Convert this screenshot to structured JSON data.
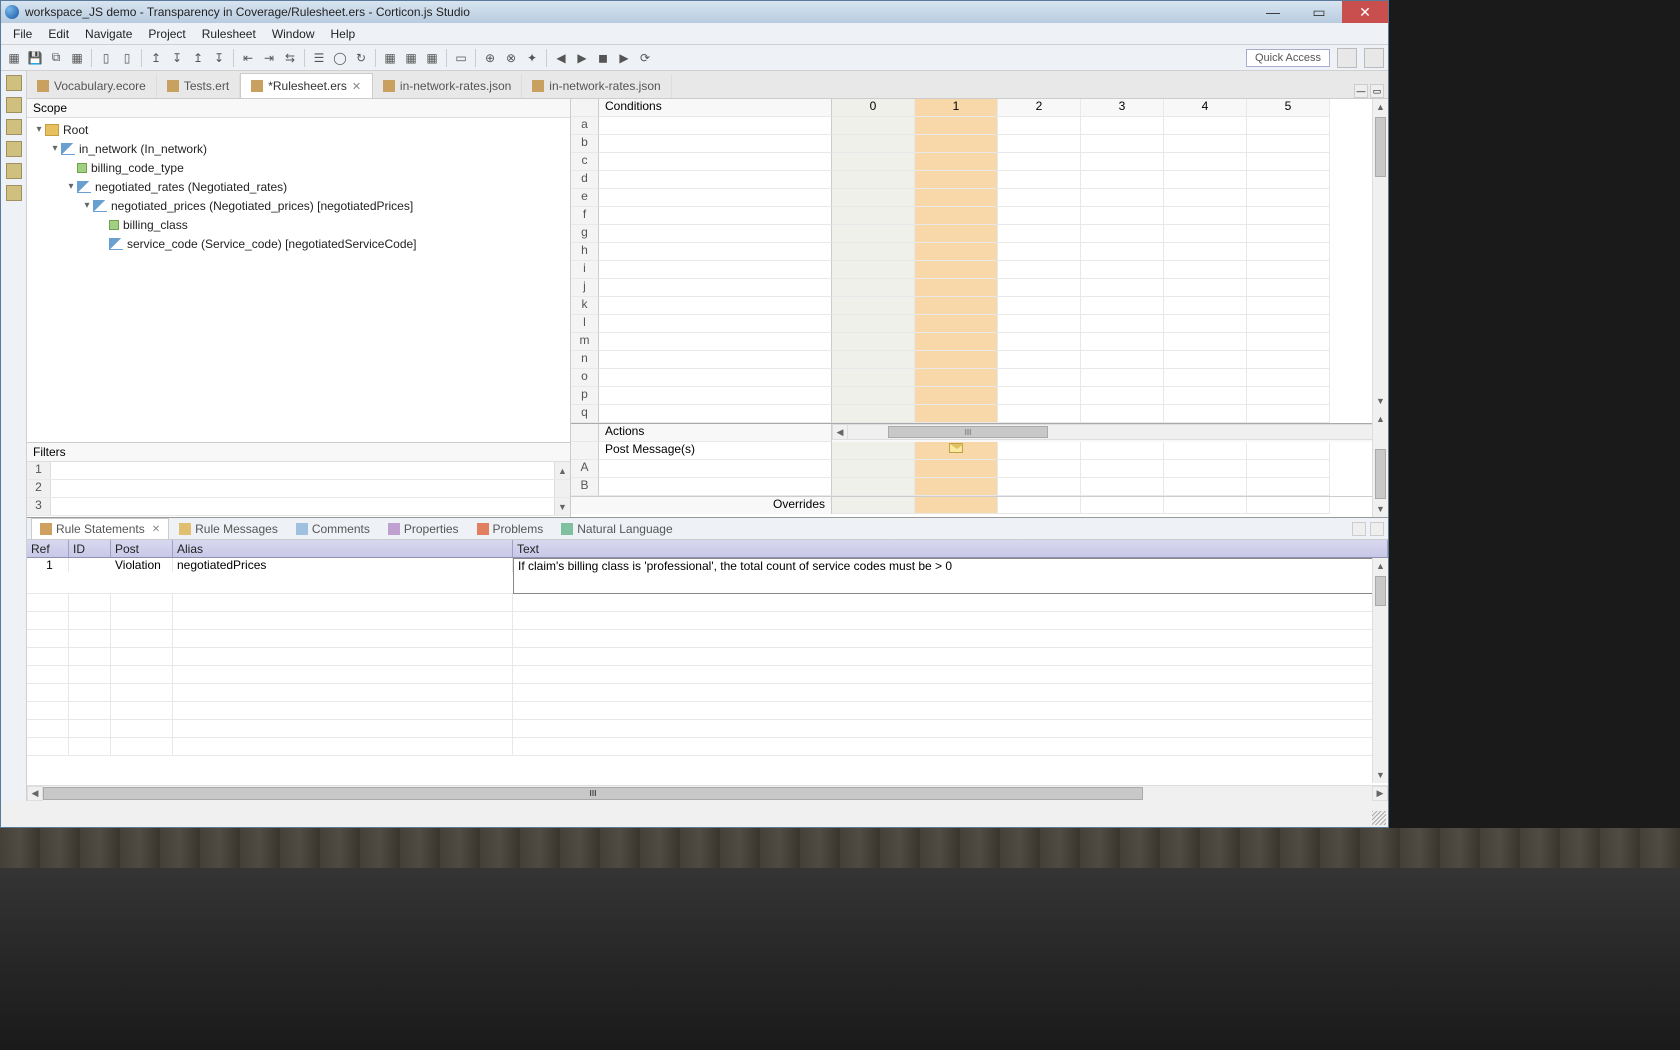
{
  "title": "workspace_JS demo - Transparency in Coverage/Rulesheet.ers - Corticon.js Studio",
  "menu": [
    "File",
    "Edit",
    "Navigate",
    "Project",
    "Rulesheet",
    "Window",
    "Help"
  ],
  "quick_access": "Quick Access",
  "tabs": [
    {
      "label": "Vocabulary.ecore",
      "active": false,
      "dirty": false
    },
    {
      "label": "Tests.ert",
      "active": false,
      "dirty": false
    },
    {
      "label": "*Rulesheet.ers",
      "active": true,
      "dirty": true
    },
    {
      "label": "in-network-rates.json",
      "active": false,
      "dirty": false
    },
    {
      "label": "in-network-rates.json",
      "active": false,
      "dirty": false
    }
  ],
  "scope": {
    "header": "Scope",
    "tree": [
      {
        "indent": 0,
        "expand": "▾",
        "icon": "folder",
        "label": "Root"
      },
      {
        "indent": 1,
        "expand": "▾",
        "icon": "link",
        "label": "in_network (In_network)"
      },
      {
        "indent": 2,
        "expand": "",
        "icon": "attr",
        "label": "billing_code_type"
      },
      {
        "indent": 2,
        "expand": "▾",
        "icon": "link",
        "label": "negotiated_rates (Negotiated_rates)"
      },
      {
        "indent": 3,
        "expand": "▾",
        "icon": "link",
        "label": "negotiated_prices (Negotiated_prices) [negotiatedPrices]"
      },
      {
        "indent": 4,
        "expand": "",
        "icon": "attr",
        "label": "billing_class"
      },
      {
        "indent": 4,
        "expand": "",
        "icon": "link",
        "label": "service_code (Service_code) [negotiatedServiceCode]"
      }
    ]
  },
  "filters": {
    "header": "Filters",
    "rows": [
      "1",
      "2",
      "3"
    ]
  },
  "grid": {
    "conditions_label": "Conditions",
    "actions_label": "Actions",
    "post_label": "Post Message(s)",
    "overrides_label": "Overrides",
    "cols": [
      "0",
      "1",
      "2",
      "3",
      "4",
      "5"
    ],
    "cond_rows": [
      "a",
      "b",
      "c",
      "d",
      "e",
      "f",
      "g",
      "h",
      "i",
      "j",
      "k",
      "l",
      "m",
      "n",
      "o",
      "p",
      "q"
    ],
    "act_rows": [
      "A",
      "B"
    ]
  },
  "bottom": {
    "tabs": [
      "Rule Statements",
      "Rule Messages",
      "Comments",
      "Properties",
      "Problems",
      "Natural Language"
    ],
    "active_tab": 0,
    "headers": {
      "ref": "Ref",
      "id": "ID",
      "post": "Post",
      "alias": "Alias",
      "text": "Text"
    },
    "rows": [
      {
        "ref": "1",
        "id": "",
        "post": "Violation",
        "alias": "negotiatedPrices",
        "text": "If claim's billing class is 'professional', the total count of service codes must be > 0"
      }
    ]
  }
}
